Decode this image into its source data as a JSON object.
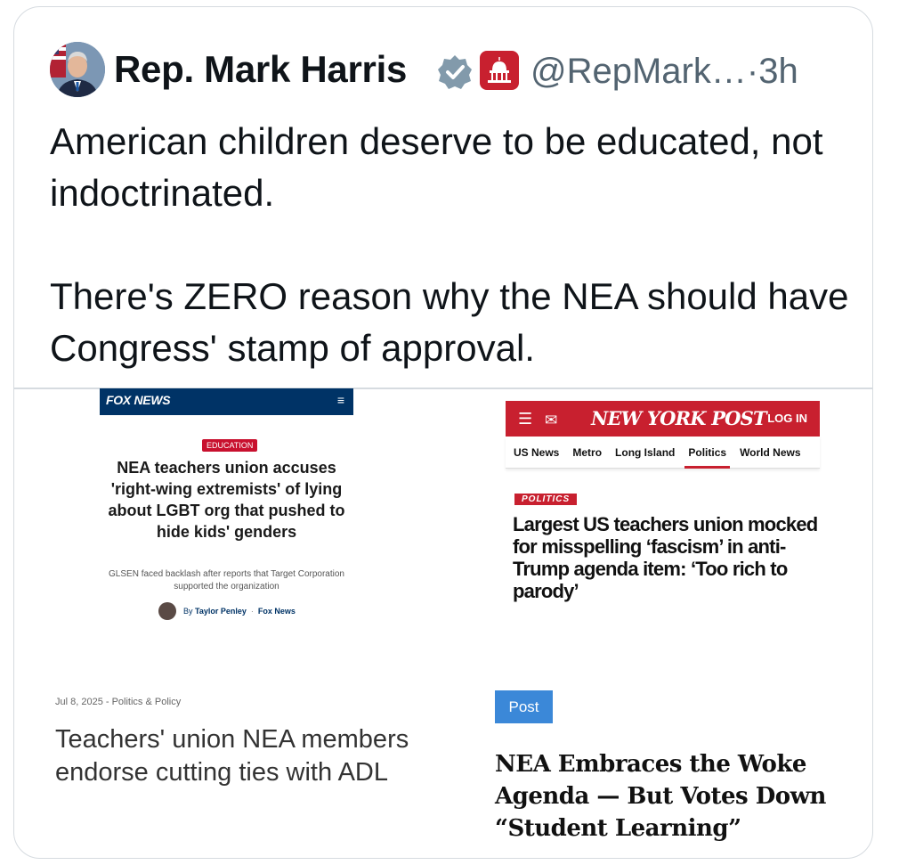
{
  "tweet": {
    "author_name": "Rep. Mark Harris",
    "handle": "@RepMark…",
    "separator": "·",
    "time": "3h",
    "verified_icon": "verified-badge-icon",
    "affiliate_icon": "house-gop-logo",
    "paragraphs": [
      "American children deserve to be educated, not indoctrinated.",
      "There's ZERO reason why the NEA should have Congress' stamp of approval."
    ]
  },
  "fox": {
    "logo": "FOX NEWS",
    "menu_icon": "≡",
    "tag": "EDUCATION",
    "headline": "NEA teachers union accuses 'right-wing extremists' of lying about LGBT org that pushed to hide kids' genders",
    "subhead": "GLSEN faced backlash after reports that Target Corporation supported the organization",
    "byline_prefix": "By",
    "author": "Taylor Penley",
    "dot": "·",
    "outlet": "Fox News"
  },
  "nypost": {
    "logo": "NEW YORK POST",
    "login": "LOG IN",
    "nav": [
      "US News",
      "Metro",
      "Long Island",
      "Politics",
      "World News"
    ],
    "active_nav": "Politics",
    "tag": "POLITICS",
    "headline": "Largest US teachers union mocked for misspelling ‘fascism’ in anti-Trump agenda item: ‘Too rich to parody’"
  },
  "article3": {
    "meta": "Jul 8, 2025 - Politics & Policy",
    "headline": "Teachers' union NEA members endorse cutting ties with ADL"
  },
  "article4": {
    "button": "Post",
    "headline": "NEA Embraces the Woke Agenda — But Votes Down “Student Learning”"
  }
}
